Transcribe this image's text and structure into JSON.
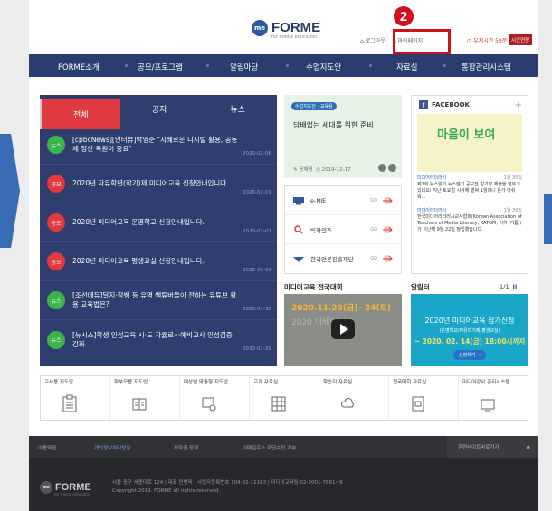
{
  "header": {
    "logo_mark": "me",
    "logo_text": "FORME",
    "logo_sub": "for media education",
    "logout": "로그아웃",
    "mypage": "마이페이지",
    "stay_time": "유지시간 59분 57초",
    "extend": "시간연장",
    "step_badge": "2"
  },
  "nav": [
    "FORME소개",
    "공모/프로그램",
    "알림마당",
    "수업지도안",
    "자료실",
    "통합관리시스템"
  ],
  "notice": {
    "tabs": [
      "전체",
      "공지",
      "뉴스"
    ],
    "items": [
      {
        "badge": "뉴스",
        "color": "#3bb54a",
        "title": "[cpbcNews][인터뷰]박영준 \"지혜로운 디지털 활용, 공동체 정신 복원이 중요\"",
        "date": "2020-02-06"
      },
      {
        "badge": "공모",
        "color": "#e0393f",
        "title": "2020년 자유학년(학기)제 미디어교육 신청안내입니다.",
        "date": "2020-02-01"
      },
      {
        "badge": "공모",
        "color": "#e0393f",
        "title": "2020년 미디어교육 운영학교 신청안내입니다.",
        "date": "2020-02-01"
      },
      {
        "badge": "공모",
        "color": "#e0393f",
        "title": "2020년 미디어교육 평생교실 신청안내입니다.",
        "date": "2020-02-01"
      },
      {
        "badge": "뉴스",
        "color": "#3bb54a",
        "title": "[조선에듀]달지·참쌤 등 유명 쌤튜버들이 전하는 유튜브 활용 교육법은?",
        "date": "2020-01-30"
      },
      {
        "badge": "뉴스",
        "color": "#3bb54a",
        "title": "[뉴시스]학생 인성교육 시·도 자율로···예비교사 인성검증 강화",
        "date": "2020-01-29"
      }
    ]
  },
  "card": {
    "tag": "수업지도안 · 교육용",
    "title": "담배없는 세대를 위한 준비",
    "author": "공채원",
    "date": "2019-12-17"
  },
  "links": [
    {
      "label": "e-NIE",
      "go": "GO"
    },
    {
      "label": "빅카인즈",
      "go": "GO"
    },
    {
      "label": "한국언론진흥재단",
      "go": "GO"
    }
  ],
  "facebook": {
    "title": "FACEBOOK",
    "image_text": "마음이 보여",
    "posts": [
      {
        "source": "미디어리터러시",
        "date": "1월 30일",
        "text": "제1회 뉴스읽기 뉴스렌기 공모전 일기장 제출을 앞두고 있네요! 지난 토요일 시작해 벌써 1월이니 돈가 아쉬워..."
      },
      {
        "source": "미디어리터러시",
        "date": "1월 30일",
        "text": "한국미디어리터러시교사협회(Korean Association of Teachers of Media Literacy, KATOM, 이하 '카톰')가 지난해 9월 22일 창립했습니다."
      }
    ]
  },
  "contest": {
    "heading": "미디어교육 전국대회",
    "line1": "2020.11.23(금)~24(토)",
    "line2": "2020 더베이101"
  },
  "alarm": {
    "heading": "알림터",
    "page": "1/1",
    "pause": "II",
    "title": "2020년 미디어교육 참가신청",
    "sub": "(운영학교/자유학기제/평생교실)",
    "deadline": "~ 2020. 02. 14(금) 18:00시까지",
    "button": "신청하기 →"
  },
  "quick": [
    "교사용 지도안",
    "학부모용 지도안",
    "대상별 맞춤형 지도안",
    "교과 자료실",
    "학습지 자료실",
    "전국대회 자료실",
    "미디어강사 관리시스템"
  ],
  "footer": {
    "links": [
      "이용약관",
      "개인정보처리방침",
      "저작권 정책",
      "이메일주소 무단수집 거부"
    ],
    "related": "관련사이트바로가기",
    "related_arrow": "▲",
    "address": "서울 중구 세종대로 124  |  대표 민병욱  |  사업자등록번호 104-82-11163  |  미디어교육팀 02-2001-7861~9",
    "copyright": "Copyright 2019. FORME all rights reserved.",
    "logo_sub": "for media education"
  }
}
